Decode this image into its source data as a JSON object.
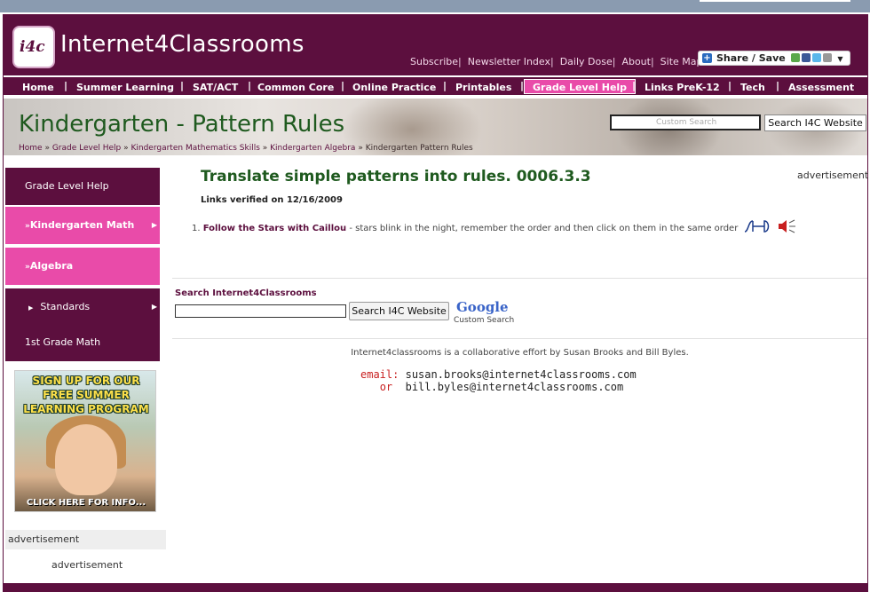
{
  "header": {
    "logo_badge": "i4c",
    "logo_text": "Internet4Classrooms",
    "top_links": [
      "Subscribe",
      "Newsletter Index",
      "Daily Dose",
      "About",
      "Site Map"
    ],
    "share_label": "Share / Save"
  },
  "nav": {
    "items": [
      "Home",
      "Summer Learning",
      "SAT/ACT",
      "Common Core",
      "Online Practice",
      "Printables",
      "Grade Level Help",
      "Links PreK-12",
      "Tech",
      "Assessment"
    ],
    "active": "Grade Level Help"
  },
  "banner": {
    "title": "Kindergarten - Pattern Rules",
    "search_placeholder": "Custom Search",
    "search_button": "Search I4C Website",
    "breadcrumbs": [
      "Home",
      "Grade Level Help",
      "Kindergarten Mathematics Skills",
      "Kindergarten Algebra",
      "Kindergarten Pattern Rules"
    ]
  },
  "sidebar": {
    "items": [
      "Grade Level Help",
      "Kindergarten Math",
      "Algebra",
      "Standards",
      "1st Grade Math"
    ],
    "promo_lines": [
      "SIGN UP FOR OUR",
      "FREE SUMMER",
      "LEARNING PROGRAM"
    ],
    "promo_cta": "CLICK HERE FOR INFO...",
    "ad_label": "advertisement",
    "ad_label2": "advertisement"
  },
  "main": {
    "heading": "Translate simple patterns into rules. 0006.3.3",
    "ad_label": "advertisement",
    "verified": "Links verified on 12/16/2009",
    "list": [
      {
        "num": "1.",
        "link": "Follow the Stars with Caillou",
        "desc": " - stars blink in the night, remember the order and then click on them in the same order"
      }
    ],
    "search": {
      "title": "Search Internet4Classrooms",
      "button": "Search I4C Website",
      "logo": "Google",
      "logo_sub": "Custom Search"
    },
    "footer_note": "Internet4classrooms is a collaborative effort by Susan Brooks and Bill Byles.",
    "contact": {
      "email_label": "email:",
      "email1": "susan.brooks@internet4classrooms.com",
      "or_label": "or",
      "email2": "bill.byles@internet4classrooms.com"
    }
  },
  "colors": {
    "primary": "#5c0f3e",
    "accent": "#e94ba9",
    "title_green": "#1f5a1f"
  }
}
